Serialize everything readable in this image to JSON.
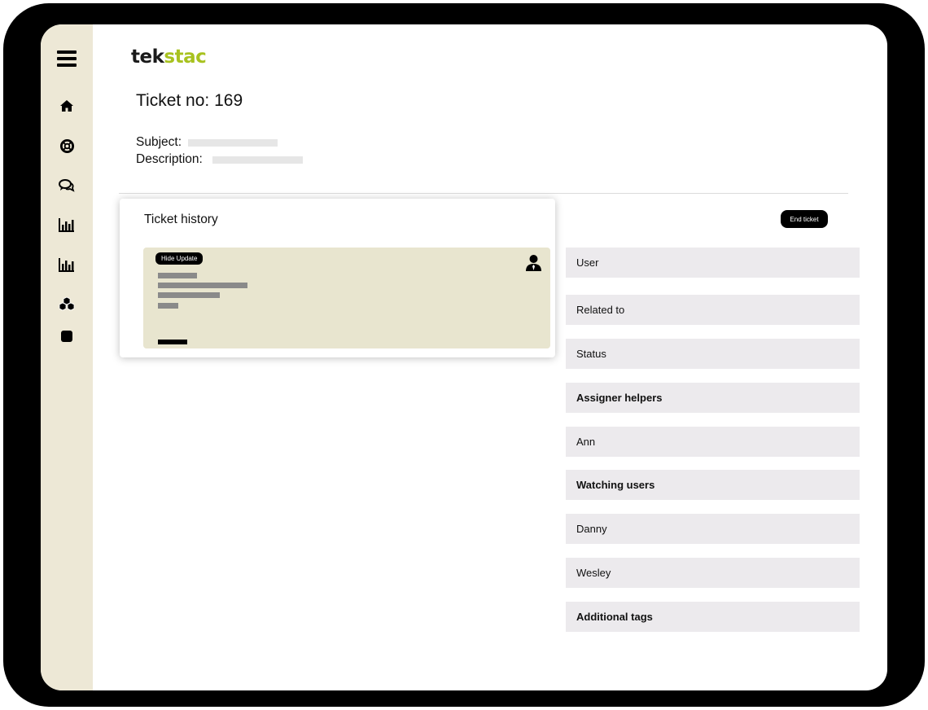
{
  "app": {
    "logo_part1": "tek",
    "logo_part2": "stac",
    "brand_color": "#a8c21f",
    "sidebar_color": "#ede8d6"
  },
  "sidebar": {
    "items": [
      {
        "icon": "menu-icon"
      },
      {
        "icon": "home-icon"
      },
      {
        "icon": "lifebuoy-icon"
      },
      {
        "icon": "chat-icon"
      },
      {
        "icon": "bar-chart-icon"
      },
      {
        "icon": "bar-chart-icon"
      },
      {
        "icon": "cubes-icon"
      },
      {
        "icon": "square-icon"
      }
    ]
  },
  "ticket": {
    "title": "Ticket no: 169",
    "subject_label": "Subject:",
    "description_label": "Description:"
  },
  "history": {
    "title": "Ticket history",
    "hide_update_label": "Hide Update"
  },
  "actions": {
    "end_ticket_label": "End ticket"
  },
  "details": [
    {
      "label": "User",
      "bold": false
    },
    {
      "label": "Related to",
      "bold": false
    },
    {
      "label": "Status",
      "bold": false
    },
    {
      "label": "Assigner helpers",
      "bold": true
    },
    {
      "label": "Ann",
      "bold": false
    },
    {
      "label": "Watching users",
      "bold": true
    },
    {
      "label": "Danny",
      "bold": false
    },
    {
      "label": "Wesley",
      "bold": false
    },
    {
      "label": "Additional tags",
      "bold": true
    }
  ]
}
